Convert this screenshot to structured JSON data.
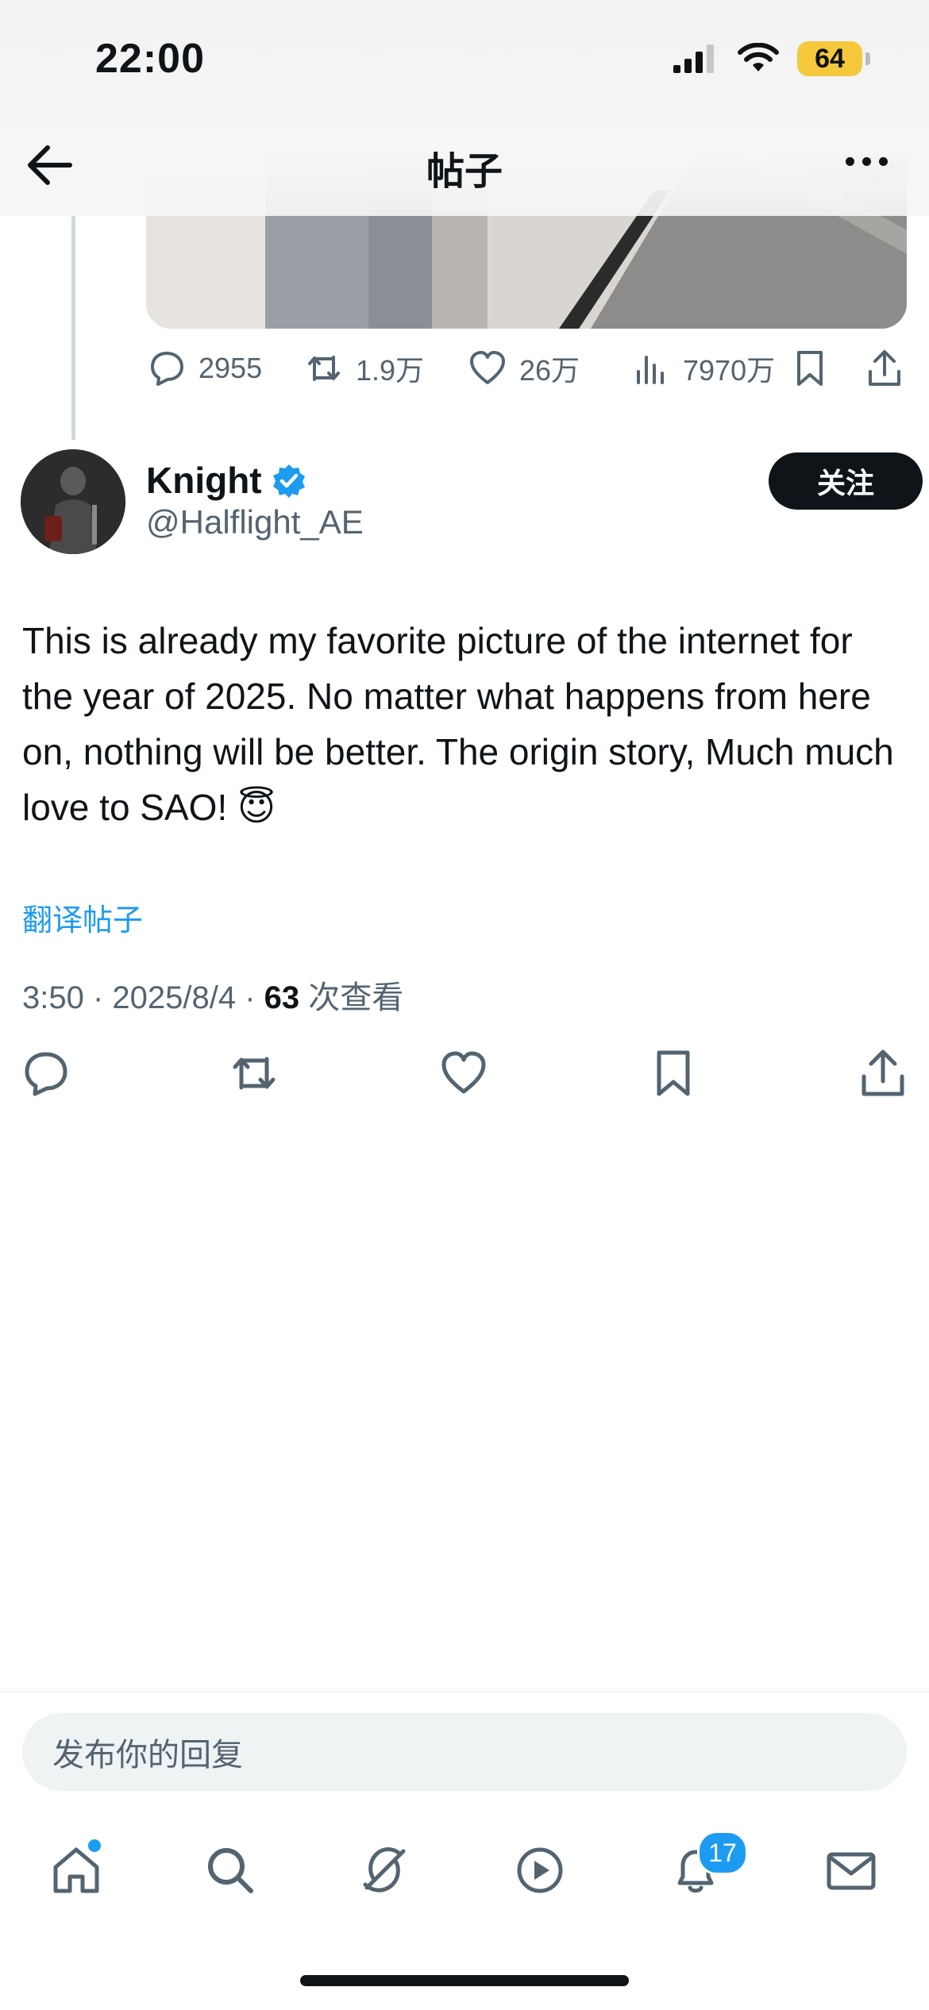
{
  "status": {
    "time": "22:00",
    "battery": "64"
  },
  "header": {
    "title": "帖子"
  },
  "previous_tweet": {
    "stats": {
      "replies": "2955",
      "reposts": "1.9万",
      "likes": "26万",
      "views": "7970万"
    }
  },
  "tweet": {
    "author_name": "Knight",
    "handle": "@Halflight_AE",
    "follow_label": "关注",
    "text": "This is already my favorite picture of the internet for the year of 2025. No matter what happens from here on, nothing will be better. The origin story, Much much love to SAO! 😇",
    "translate_label": "翻译帖子",
    "timestamp": "3:50 · 2025/8/4 · ",
    "views_count": "63",
    "views_label": " 次查看"
  },
  "reply": {
    "placeholder": "发布你的回复"
  },
  "tabbar": {
    "notifications_badge": "17"
  },
  "colors": {
    "accent": "#1d9bf0",
    "text": "#0f1419",
    "secondary": "#536471",
    "battery": "#f5c93b"
  }
}
